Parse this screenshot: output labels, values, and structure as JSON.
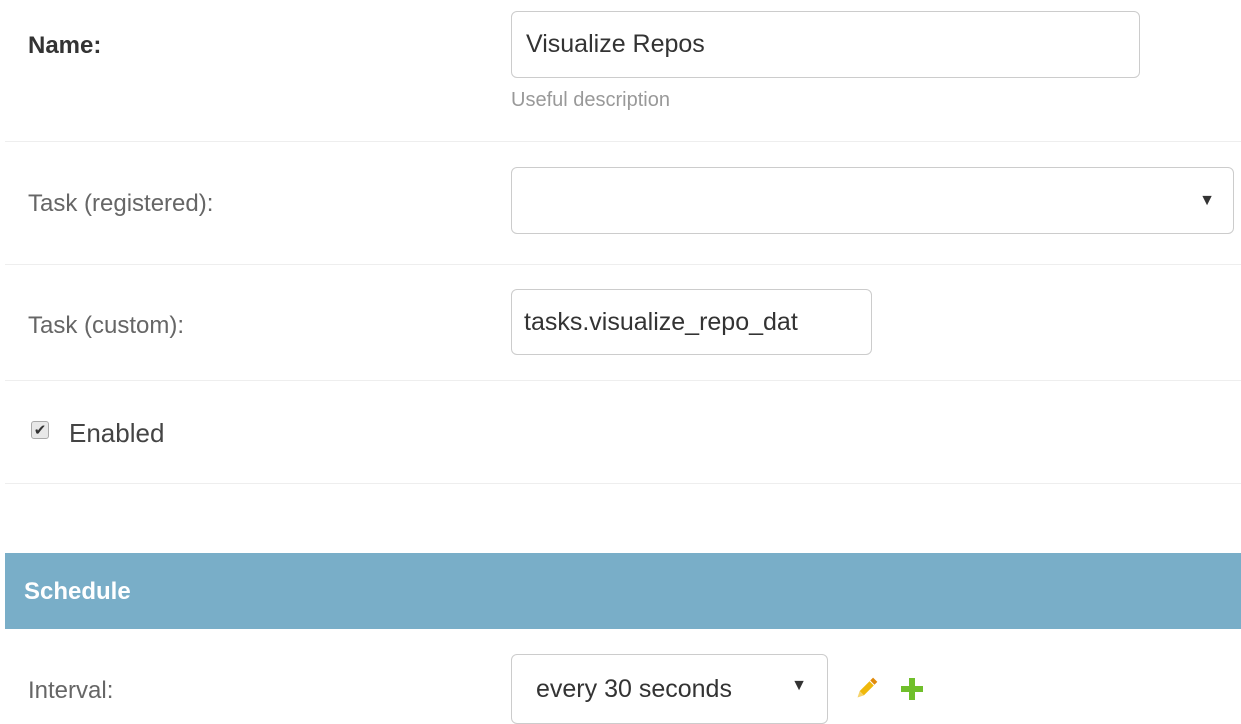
{
  "form": {
    "name": {
      "label": "Name:",
      "value": "Visualize Repos",
      "help": "Useful description"
    },
    "task_registered": {
      "label": "Task (registered):",
      "selected": ""
    },
    "task_custom": {
      "label": "Task (custom):",
      "value": "tasks.visualize_repo_dat"
    },
    "enabled": {
      "label": "Enabled",
      "checked": true
    }
  },
  "schedule": {
    "title": "Schedule",
    "interval": {
      "label": "Interval:",
      "selected": "every 30 seconds",
      "actions": {
        "edit_icon": "pencil-icon",
        "add_icon": "plus-icon"
      }
    }
  },
  "colors": {
    "fieldset_header": "#79aec8",
    "edit_icon": "#efb80b",
    "add_icon": "#70bf2b"
  }
}
